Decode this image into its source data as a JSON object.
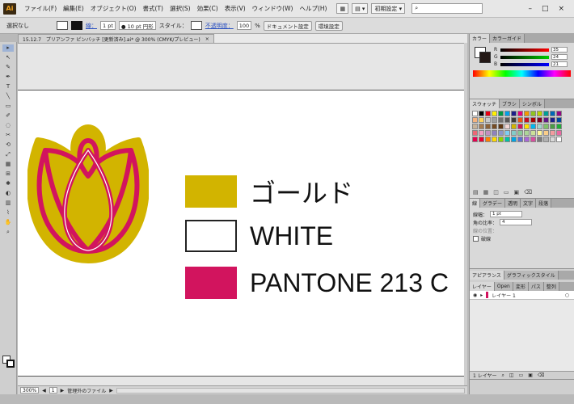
{
  "app": {
    "logo": "Ai"
  },
  "menu": [
    "ファイル(F)",
    "編集(E)",
    "オブジェクト(O)",
    "書式(T)",
    "選択(S)",
    "効果(C)",
    "表示(V)",
    "ウィンドウ(W)",
    "ヘルプ(H)"
  ],
  "menubar": {
    "workspace": "初期設定 ▾",
    "search_placeholder": "",
    "window_controls": [
      "–",
      "□",
      "×"
    ]
  },
  "control_bar": {
    "selection": "選択なし",
    "stroke_label": "線：",
    "stroke_weight": "1 pt",
    "brush": "● 10 pt 円形",
    "style_label": "スタイル：",
    "opacity_label": "不透明度：",
    "opacity_value": "100",
    "opacity_unit": "%",
    "doc_setup_button": "ドキュメント設定",
    "prefs_button": "環境設定"
  },
  "doc_tab": {
    "title": "15.12.7　プリアンファ ピンバッチ [更新済み].ai* @ 300% (CMYK/プレビュー)",
    "close": "×"
  },
  "legend": [
    {
      "label": "ゴールド",
      "color": "#d2b400",
      "outline": false
    },
    {
      "label": "WHITE",
      "color": "#ffffff",
      "outline": true
    },
    {
      "label": "PANTONE 213 C",
      "color": "#d2145e",
      "outline": false
    }
  ],
  "logo_colors": {
    "gold": "#d2b400",
    "magenta": "#d2145e",
    "white": "#ffffff"
  },
  "statusbar": {
    "zoom": "300%",
    "page": "1",
    "tool_status": "管理外のファイル"
  },
  "panels": {
    "color_tabs": [
      "カラー",
      "カラーガイド"
    ],
    "color_values": {
      "r": "35",
      "g": "24",
      "b": "21"
    },
    "swatch_tabs": [
      "スウォッチ",
      "ブラシ",
      "シンボル"
    ],
    "stroke_tabs": [
      "線",
      "グラデー",
      "透明",
      "文字",
      "段落"
    ],
    "stroke": {
      "weight_label": "線幅：",
      "weight": "1 pt",
      "miter_label": "角の比率：",
      "miter": "4",
      "align_label": "線の位置：",
      "dash_label": "破線"
    },
    "appearance_tabs": [
      "アピアランス",
      "グラフィックスタイル"
    ],
    "layers_tabs": [
      "レイヤー",
      "Open",
      "変形",
      "パス",
      "整列"
    ],
    "layer_name": "レイヤー 1",
    "layers_count": "1 レイヤー"
  },
  "tools": [
    "▸",
    "↖",
    "✎",
    "✒",
    "T",
    "╲",
    "▭",
    "✐",
    "◌",
    "✂",
    "⟲",
    "⤢",
    "▦",
    "⊞",
    "✱",
    "◐",
    "▥",
    "⌇",
    "✋",
    "⌕"
  ]
}
